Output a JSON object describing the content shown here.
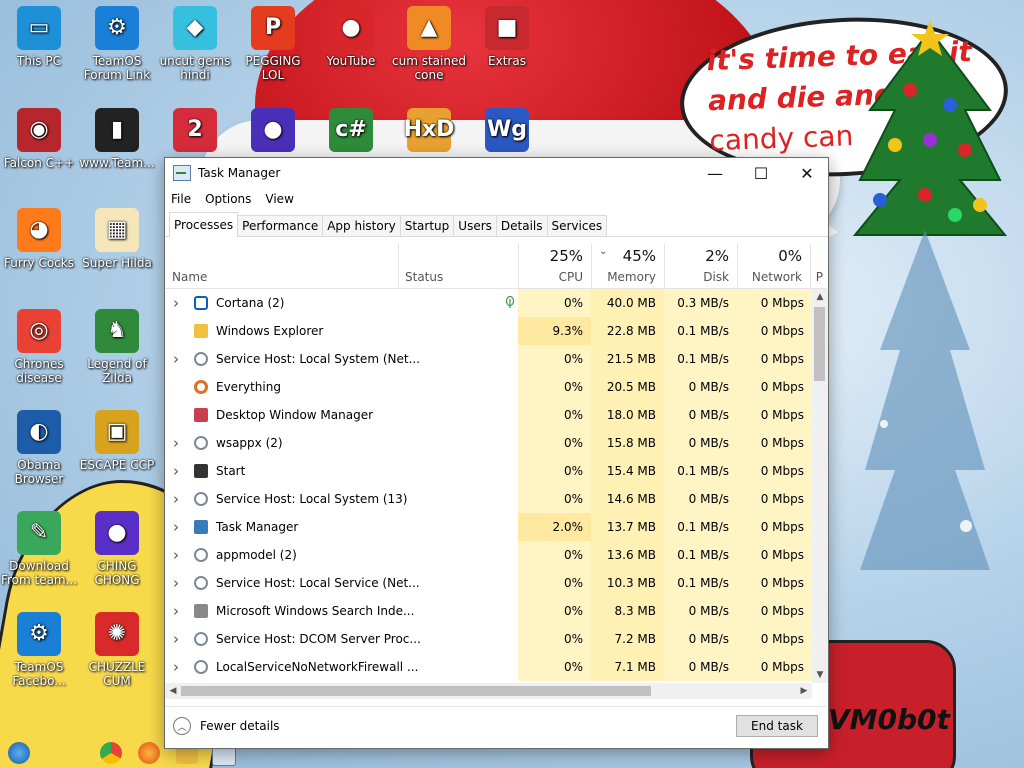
{
  "desktop": {
    "bubble_lines": [
      "it's time to eat it",
      "and die and",
      "candy can"
    ],
    "signature": "VM0b0t",
    "icons": [
      {
        "label": "This PC",
        "icon": "monitor-icon",
        "color": "#1e90d8"
      },
      {
        "label": "TeamOS Forum Link",
        "icon": "gear-icon",
        "color": "#1a7fd6"
      },
      {
        "label": "uncut gems hindi",
        "icon": "diamond-icon",
        "color": "#36c0e0"
      },
      {
        "label": "PEGGING LOL",
        "icon": "p-logo-icon",
        "color": "#e53b1f"
      },
      {
        "label": "YouTube",
        "icon": "angry-bird-icon",
        "color": "#d8262a"
      },
      {
        "label": "cum stained cone",
        "icon": "cone-icon",
        "color": "#f08a24"
      },
      {
        "label": "Extras",
        "icon": "box-icon",
        "color": "#c8292e"
      },
      {
        "label": "Falcon C++",
        "icon": "falcon-icon",
        "color": "#b7262c"
      },
      {
        "label": "www.Team...",
        "icon": "phone-icon",
        "color": "#222222"
      },
      {
        "label": "",
        "icon": "number-two-icon",
        "color": "#d42c3a"
      },
      {
        "label": "",
        "icon": "orb-icon",
        "color": "#4a2fb8"
      },
      {
        "label": "",
        "icon": "csharp-icon",
        "color": "#2e8b3a"
      },
      {
        "label": "",
        "icon": "hxd-icon",
        "color": "#e8a030"
      },
      {
        "label": "",
        "icon": "wg-icon",
        "color": "#2b59c3"
      },
      {
        "label": "Furry Cocks",
        "icon": "firefox-icon",
        "color": "#ff7a1a"
      },
      {
        "label": "Super Hilda",
        "icon": "pixel-icon",
        "color": "#f4e6b8"
      },
      {
        "label": "Chrones disease",
        "icon": "chrome-icon",
        "color": "#e94235"
      },
      {
        "label": "Legend of Zilda",
        "icon": "zelda-icon",
        "color": "#2f8a3c"
      },
      {
        "label": "Obama Browser",
        "icon": "obama-logo-icon",
        "color": "#1c5ca8"
      },
      {
        "label": "ESCAPE CCP",
        "icon": "escape-icon",
        "color": "#d8a21c"
      },
      {
        "label": "Download From team...",
        "icon": "notepad-icon",
        "color": "#3aa85a"
      },
      {
        "label": "CHING CHONG",
        "icon": "bomb-orb-icon",
        "color": "#5a2fc8"
      },
      {
        "label": "TeamOS Facebo...",
        "icon": "gear-icon",
        "color": "#1a7fd6"
      },
      {
        "label": "CHUZZLE CUM",
        "icon": "chuzzle-icon",
        "color": "#d82a2a"
      }
    ]
  },
  "window": {
    "title": "Task Manager",
    "minimize_glyph": "—",
    "maximize_glyph": "☐",
    "close_glyph": "✕",
    "menu": [
      "File",
      "Options",
      "View"
    ],
    "tabs": [
      "Processes",
      "Performance",
      "App history",
      "Startup",
      "Users",
      "Details",
      "Services"
    ],
    "active_tab": "Processes"
  },
  "columns": {
    "name": "Name",
    "status": "Status",
    "cpu": {
      "label": "CPU",
      "percent": "25%"
    },
    "memory": {
      "label": "Memory",
      "percent": "45%"
    },
    "disk": {
      "label": "Disk",
      "percent": "2%"
    },
    "network": {
      "label": "Network",
      "percent": "0%"
    },
    "overflow": "P"
  },
  "rows": [
    {
      "name": "Cortana (2)",
      "expand": true,
      "icon": "cortana-icon",
      "cpu": "0%",
      "memory": "40.0 MB",
      "disk": "0.3 MB/s",
      "network": "0 Mbps",
      "eco": true
    },
    {
      "name": "Windows Explorer",
      "expand": false,
      "icon": "folder-icon",
      "cpu": "9.3%",
      "memory": "22.8 MB",
      "disk": "0.1 MB/s",
      "network": "0 Mbps",
      "eco": false
    },
    {
      "name": "Service Host: Local System (Net...",
      "expand": true,
      "icon": "service-gear-icon",
      "cpu": "0%",
      "memory": "21.5 MB",
      "disk": "0.1 MB/s",
      "network": "0 Mbps",
      "eco": false
    },
    {
      "name": "Everything",
      "expand": false,
      "icon": "magnifier-icon",
      "cpu": "0%",
      "memory": "20.5 MB",
      "disk": "0 MB/s",
      "network": "0 Mbps",
      "eco": false
    },
    {
      "name": "Desktop Window Manager",
      "expand": false,
      "icon": "dwm-icon",
      "cpu": "0%",
      "memory": "18.0 MB",
      "disk": "0 MB/s",
      "network": "0 Mbps",
      "eco": false
    },
    {
      "name": "wsappx (2)",
      "expand": true,
      "icon": "service-gear-icon",
      "cpu": "0%",
      "memory": "15.8 MB",
      "disk": "0 MB/s",
      "network": "0 Mbps",
      "eco": false
    },
    {
      "name": "Start",
      "expand": true,
      "icon": "start-window-icon",
      "cpu": "0%",
      "memory": "15.4 MB",
      "disk": "0.1 MB/s",
      "network": "0 Mbps",
      "eco": false
    },
    {
      "name": "Service Host: Local System (13)",
      "expand": true,
      "icon": "service-gear-icon",
      "cpu": "0%",
      "memory": "14.6 MB",
      "disk": "0 MB/s",
      "network": "0 Mbps",
      "eco": false
    },
    {
      "name": "Task Manager",
      "expand": true,
      "icon": "task-manager-icon",
      "cpu": "2.0%",
      "memory": "13.7 MB",
      "disk": "0.1 MB/s",
      "network": "0 Mbps",
      "eco": false
    },
    {
      "name": "appmodel (2)",
      "expand": true,
      "icon": "service-gear-icon",
      "cpu": "0%",
      "memory": "13.6 MB",
      "disk": "0.1 MB/s",
      "network": "0 Mbps",
      "eco": false
    },
    {
      "name": "Service Host: Local Service (Net...",
      "expand": true,
      "icon": "service-gear-icon",
      "cpu": "0%",
      "memory": "10.3 MB",
      "disk": "0.1 MB/s",
      "network": "0 Mbps",
      "eco": false
    },
    {
      "name": "Microsoft Windows Search Inde...",
      "expand": true,
      "icon": "search-indexer-icon",
      "cpu": "0%",
      "memory": "8.3 MB",
      "disk": "0 MB/s",
      "network": "0 Mbps",
      "eco": false
    },
    {
      "name": "Service Host: DCOM Server Proc...",
      "expand": true,
      "icon": "service-gear-icon",
      "cpu": "0%",
      "memory": "7.2 MB",
      "disk": "0 MB/s",
      "network": "0 Mbps",
      "eco": false
    },
    {
      "name": "LocalServiceNoNetworkFirewall ...",
      "expand": true,
      "icon": "service-gear-icon",
      "cpu": "0%",
      "memory": "7.1 MB",
      "disk": "0 MB/s",
      "network": "0 Mbps",
      "eco": false
    }
  ],
  "footer": {
    "fewer_details": "Fewer details",
    "end_task": "End task"
  },
  "colors": {
    "cpu_light": "#fff4c4",
    "cpu_mid": "#ffe9a0",
    "mem_col": "#fff0b4",
    "disk_col": "#fff4c4",
    "net_col": "#fff4c4"
  }
}
